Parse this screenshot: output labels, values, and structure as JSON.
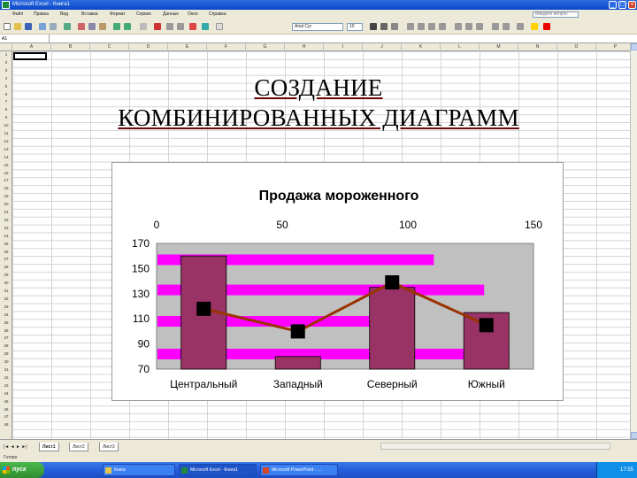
{
  "window": {
    "title": "Microsoft Excel - Книга1",
    "buttons": [
      "_",
      "□",
      "×"
    ]
  },
  "menu": {
    "items": [
      "Файл",
      "Правка",
      "Вид",
      "Вставка",
      "Формат",
      "Сервис",
      "Данные",
      "Окно",
      "Справка"
    ],
    "question_placeholder": "Введите вопрос"
  },
  "toolbar": {
    "font_name": "Arial Cyr",
    "font_size": "10"
  },
  "formula_bar": {
    "cell_ref": "A1",
    "content": ""
  },
  "sheet": {
    "columns": [
      "A",
      "B",
      "C",
      "D",
      "E",
      "F",
      "G",
      "H",
      "I",
      "J",
      "K",
      "L",
      "M",
      "N",
      "O",
      "P"
    ],
    "rows": [
      "1",
      "2",
      "3",
      "4",
      "5",
      "6",
      "7",
      "8",
      "9",
      "10",
      "11",
      "12",
      "13",
      "14",
      "15",
      "16",
      "17",
      "18",
      "19",
      "20",
      "21",
      "22",
      "23",
      "24",
      "25",
      "26",
      "27",
      "28",
      "29",
      "30",
      "31",
      "32",
      "33",
      "34",
      "35",
      "36",
      "37",
      "38",
      "39",
      "40",
      "41",
      "42",
      "43",
      "44",
      "45",
      "46",
      "47",
      "48"
    ]
  },
  "heading": {
    "line1": "СОЗДАНИЕ",
    "line2": "КОМБИНИРОВАННЫХ ДИАГРАММ"
  },
  "chart_data": {
    "type": "bar",
    "title": "Продажа мороженного",
    "categories": [
      "Центральный",
      "Западный",
      "Северный",
      "Южный"
    ],
    "ylim": [
      70,
      170
    ],
    "y_ticks": [
      70,
      90,
      110,
      130,
      150,
      170
    ],
    "x2lim": [
      0,
      150
    ],
    "x2_ticks": [
      0,
      50,
      100,
      150
    ],
    "legend": "none",
    "series": [
      {
        "kind": "column",
        "values": [
          160,
          80,
          135,
          115
        ],
        "color": "#993366"
      },
      {
        "kind": "line",
        "values": [
          118,
          100,
          139,
          105
        ],
        "color": "#993300",
        "marker_color": "#000000"
      },
      {
        "kind": "horizontal-bar",
        "axis": "secondary",
        "values": [
          110,
          130,
          85,
          140
        ],
        "color": "#ff00ff"
      }
    ],
    "plot_background": "#c0c0c0"
  },
  "tabs": {
    "nav": "|◄ ◄ ► ►|",
    "items": [
      "Лист1",
      "Лист2",
      "Лист3"
    ]
  },
  "status": {
    "text": "Готово"
  },
  "taskbar": {
    "start": "пуск",
    "tasks": [
      "Книга",
      "Microsoft Excel - Книга1",
      "Microsoft PowerPoint - ..."
    ],
    "clock": "17:55"
  }
}
